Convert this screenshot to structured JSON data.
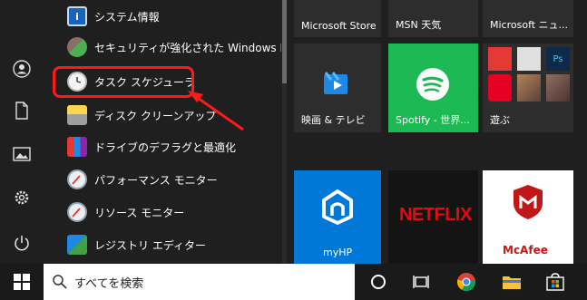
{
  "app_list": {
    "items": [
      {
        "label": "システム情報",
        "icon": "system-info-icon"
      },
      {
        "label": "セキュリティが強化された Windows Defe",
        "icon": "firewall-icon"
      },
      {
        "label": "タスク スケジューラ",
        "icon": "clock-icon"
      },
      {
        "label": "ディスク クリーンアップ",
        "icon": "disk-cleanup-icon"
      },
      {
        "label": "ドライブのデフラグと最適化",
        "icon": "defrag-icon"
      },
      {
        "label": "パフォーマンス モニター",
        "icon": "monitor-icon"
      },
      {
        "label": "リソース モニター",
        "icon": "monitor-icon"
      },
      {
        "label": "レジストリ エディター",
        "icon": "registry-icon"
      }
    ]
  },
  "tiles": {
    "microsoft_store": "Microsoft Store",
    "msn_weather": "MSN 天気",
    "microsoft_news": "Microsoft ニュ...",
    "movies_tv": "映画 & テレビ",
    "spotify": "Spotify - 世界...",
    "play": "遊ぶ",
    "netflix": "NETFLIX",
    "myhp": "myHP",
    "mcafee": "McAfee"
  },
  "taskbar": {
    "search_text": "すべてを検索"
  },
  "colors": {
    "highlight": "#ff1a1a",
    "tile_blue": "#0078d7",
    "spotify_green": "#1db954",
    "netflix_red": "#e50914",
    "mcafee_red": "#c01818"
  }
}
